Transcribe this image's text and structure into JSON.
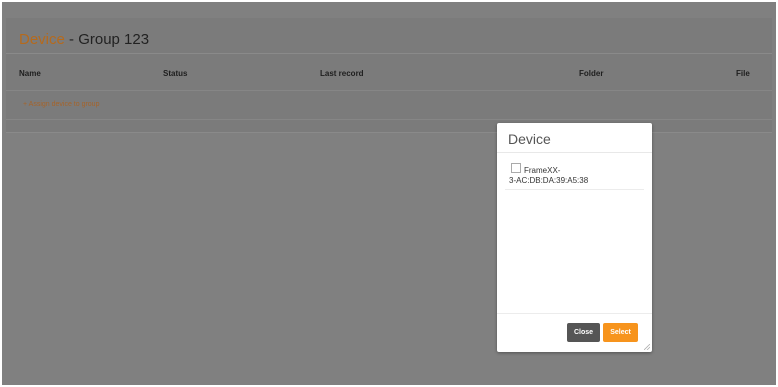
{
  "page": {
    "title_accent": "Device",
    "title_rest": " - Group 123"
  },
  "table": {
    "headers": [
      "Name",
      "Status",
      "Last record",
      "Folder",
      "File"
    ],
    "assign_link": "+ Assign device to group"
  },
  "modal": {
    "title": "Device",
    "items": [
      {
        "label_line1": "FrameXX-",
        "label_line2": "3-AC:DB:DA:39:A5:38",
        "checked": false
      }
    ],
    "close_label": "Close",
    "select_label": "Select"
  },
  "colors": {
    "overlay": "#808080",
    "accent": "#b56a1d",
    "select_button": "#f7941d",
    "close_button": "#555555"
  }
}
